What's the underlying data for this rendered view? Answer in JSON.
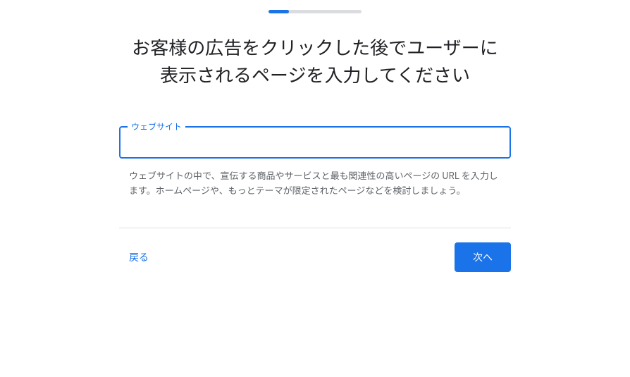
{
  "progress": {
    "percent": 22
  },
  "heading": {
    "line1": "お客様の広告をクリックした後でユーザーに",
    "line2": "表示されるページを入力してください"
  },
  "form": {
    "input_label": "ウェブサイト",
    "input_value": "",
    "helper_text": "ウェブサイトの中で、宣伝する商品やサービスと最も関連性の高いページの URL を入力します。ホームページや、もっとテーマが限定されたページなどを検討しましょう。"
  },
  "navigation": {
    "back_label": "戻る",
    "next_label": "次へ"
  }
}
